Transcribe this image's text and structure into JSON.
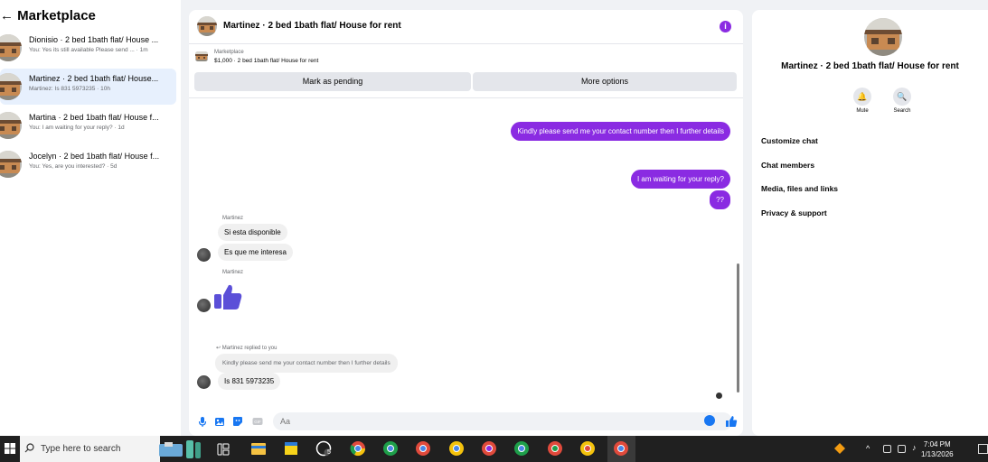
{
  "sidebar": {
    "title": "Marketplace",
    "conversations": [
      {
        "name": "Dionisio · 2 bed 1bath flat/ House ...",
        "preview": "You: Yes its still available Please send ... · 1m",
        "active": false
      },
      {
        "name": "Martinez · 2 bed 1bath flat/ House...",
        "preview": "Martinez: Is 831 5973235 · 10h",
        "active": true
      },
      {
        "name": "Martina · 2 bed 1bath flat/ House f...",
        "preview": "You: I am waiting for your reply? · 1d",
        "active": false
      },
      {
        "name": "Jocelyn · 2 bed 1bath flat/ House f...",
        "preview": "You: Yes, are you interested? · 5d",
        "active": false
      }
    ]
  },
  "chat": {
    "title": "Martinez · 2 bed 1bath flat/ House for rent",
    "info_icon": "info-icon",
    "listing": {
      "source": "Marketplace",
      "detail": "$1,000 · 2 bed 1bath flat/ House for rent",
      "pending_label": "Mark as pending",
      "more_label": "More options"
    },
    "messages": {
      "out1": "Kindly please send me your contact number then I further details",
      "out2": "I am waiting for your reply?",
      "out3": "??",
      "sender1": "Martinez",
      "in1": "Si esta disponible",
      "in2": "Es que me interesa",
      "sender2": "Martinez",
      "reply_note": "Martinez replied to you",
      "reply_quote": "Kindly please send me your contact number then I further details",
      "in3": "Is 831 5973235"
    },
    "composer": {
      "placeholder": "Aa",
      "icons": [
        "microphone-icon",
        "image-icon",
        "sticker-icon",
        "gif-icon",
        "emoji-icon",
        "thumbs-up-icon"
      ]
    }
  },
  "info_panel": {
    "title": "Martinez · 2 bed 1bath flat/ House for rent",
    "mute_label": "Mute",
    "search_label": "Search",
    "items": [
      "Customize chat",
      "Chat members",
      "Media, files and links",
      "Privacy & support"
    ]
  },
  "taskbar": {
    "search_placeholder": "Type here to search",
    "whatsapp_badge": "5",
    "time": "7:04 PM",
    "date": "1/13/2026"
  },
  "colors": {
    "accent": "#8a2be2",
    "like_blue": "#1877f2",
    "active_row": "#e7f0fd"
  }
}
